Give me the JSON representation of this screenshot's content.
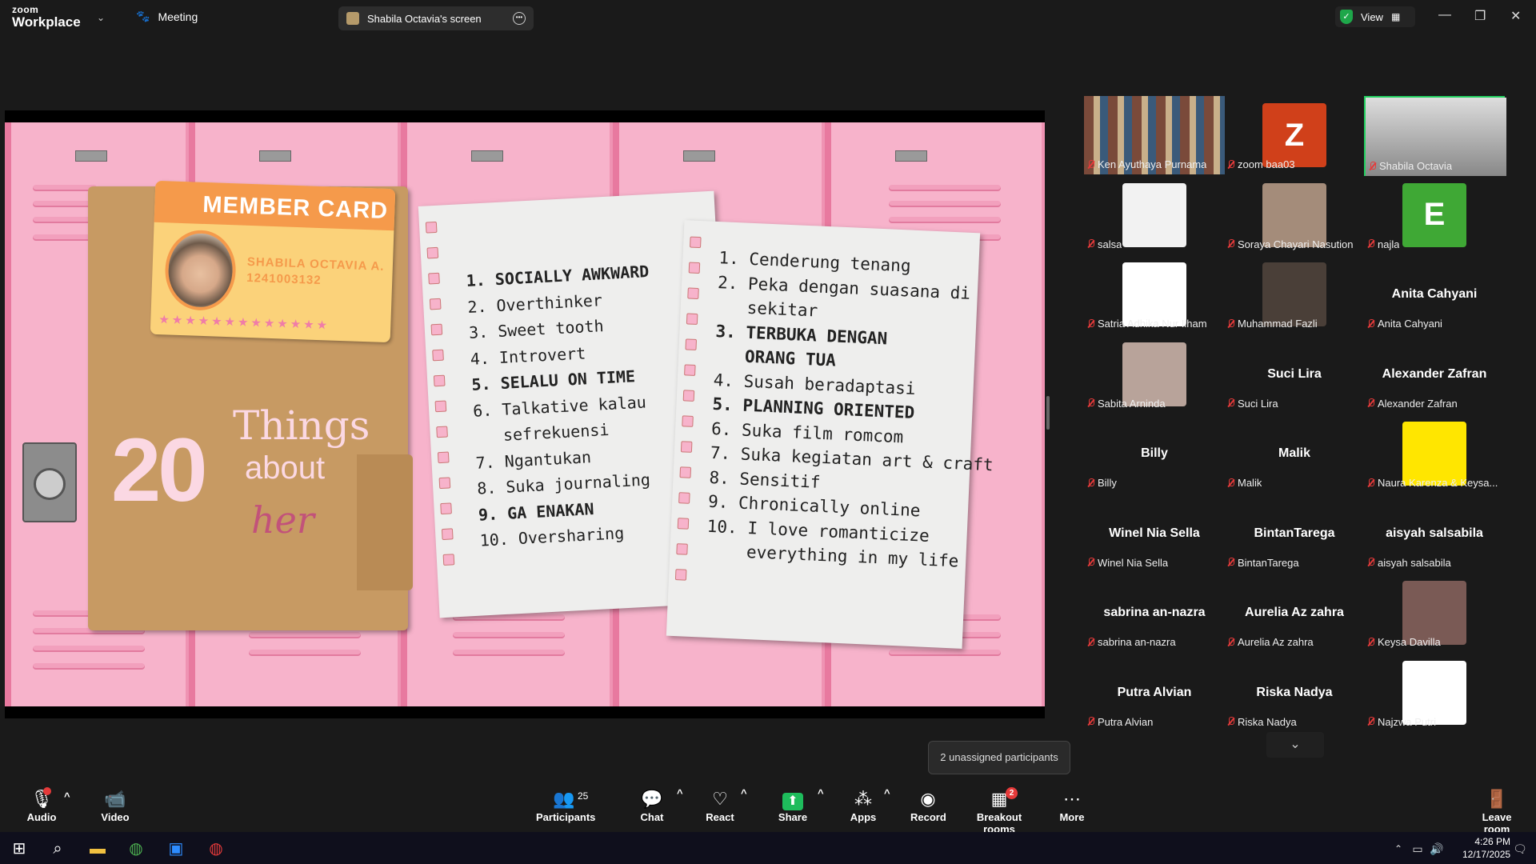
{
  "app": {
    "brand_small": "zoom",
    "brand_big": "Workplace"
  },
  "tabs": {
    "meeting": "Meeting",
    "screen": "Shabila Octavia's screen"
  },
  "view_label": "View",
  "slide": {
    "card_title": "MEMBER CARD",
    "card_name": "SHABILA OCTAVIA A.",
    "card_id": "1241003132",
    "card_stars": "★★★★★★★★★★★★★",
    "big_number": "20",
    "things": "Things",
    "about": "about",
    "her": "her",
    "list1": [
      {
        "t": "1. SOCIALLY AWKWARD",
        "b": true
      },
      {
        "t": "2. Overthinker",
        "b": false
      },
      {
        "t": "3. Sweet tooth",
        "b": false
      },
      {
        "t": "4. Introvert",
        "b": false
      },
      {
        "t": "5. SELALU ON TIME",
        "b": true
      },
      {
        "t": "6. Talkative kalau",
        "b": false
      },
      {
        "t": "   sefrekuensi",
        "b": false
      },
      {
        "t": "7. Ngantukan",
        "b": false
      },
      {
        "t": "8. Suka journaling",
        "b": false
      },
      {
        "t": "9. GA ENAKAN",
        "b": true
      },
      {
        "t": "10. Oversharing",
        "b": false
      }
    ],
    "list2": [
      {
        "t": "1. Cenderung tenang",
        "b": false
      },
      {
        "t": "2. Peka dengan suasana di",
        "b": false
      },
      {
        "t": "   sekitar",
        "b": false
      },
      {
        "t": "3. TERBUKA DENGAN",
        "b": true
      },
      {
        "t": "   ORANG TUA",
        "b": true
      },
      {
        "t": "4. Susah beradaptasi",
        "b": false
      },
      {
        "t": "5. PLANNING ORIENTED",
        "b": true
      },
      {
        "t": "6. Suka film romcom",
        "b": false
      },
      {
        "t": "7. Suka kegiatan art & craft",
        "b": false
      },
      {
        "t": "8. Sensitif",
        "b": false
      },
      {
        "t": "9. Chronically online",
        "b": false
      },
      {
        "t": "10. I love romanticize",
        "b": false
      },
      {
        "t": "    everything in my life",
        "b": false
      }
    ]
  },
  "participants": [
    {
      "label": "Ken Ayuthaya Purnama",
      "big": "",
      "kind": "photo",
      "color": "#8a7a6a"
    },
    {
      "label": "zoom baa03",
      "big": "Z",
      "kind": "avatar",
      "color": "#d0401a"
    },
    {
      "label": "Shabila Octavia",
      "big": "",
      "kind": "photo",
      "color": "#6d6d70"
    },
    {
      "label": "salsa",
      "big": "",
      "kind": "avatar",
      "color": "#f2f2f2"
    },
    {
      "label": "Soraya Chayari Nasution",
      "big": "",
      "kind": "avatar",
      "color": "#a48c7a"
    },
    {
      "label": "najla",
      "big": "E",
      "kind": "avatar",
      "color": "#3fa835"
    },
    {
      "label": "Satria Adhika Nur Ilham",
      "big": "",
      "kind": "avatar",
      "color": "#ffffff"
    },
    {
      "label": "Muhammad Fazli",
      "big": "",
      "kind": "avatar",
      "color": "#4a3f38"
    },
    {
      "label": "Anita Cahyani",
      "big": "Anita Cahyani",
      "kind": "name",
      "color": ""
    },
    {
      "label": "Sabita Arninda",
      "big": "",
      "kind": "avatar",
      "color": "#b8a39a"
    },
    {
      "label": "Suci Lira",
      "big": "Suci Lira",
      "kind": "name",
      "color": ""
    },
    {
      "label": "Alexander Zafran",
      "big": "Alexander Zafran",
      "kind": "name",
      "color": ""
    },
    {
      "label": "Billy",
      "big": "Billy",
      "kind": "name",
      "color": ""
    },
    {
      "label": "Malik",
      "big": "Malik",
      "kind": "name",
      "color": ""
    },
    {
      "label": "Naura Karenza & Keysa...",
      "big": "",
      "kind": "avatar",
      "color": "#ffe600"
    },
    {
      "label": "Winel Nia Sella",
      "big": "Winel Nia Sella",
      "kind": "name",
      "color": ""
    },
    {
      "label": "BintanTarega",
      "big": "BintanTarega",
      "kind": "name",
      "color": ""
    },
    {
      "label": "aisyah salsabila",
      "big": "aisyah salsabila",
      "kind": "name",
      "color": ""
    },
    {
      "label": "sabrina an-nazra",
      "big": "sabrina an-nazra",
      "kind": "name",
      "color": ""
    },
    {
      "label": "Aurelia Az zahra",
      "big": "Aurelia Az zahra",
      "kind": "name",
      "color": ""
    },
    {
      "label": "Keysa Davilla",
      "big": "",
      "kind": "avatar",
      "color": "#7a5a55"
    },
    {
      "label": "Putra Alvian",
      "big": "Putra Alvian",
      "kind": "name",
      "color": ""
    },
    {
      "label": "Riska Nadya",
      "big": "Riska Nadya",
      "kind": "name",
      "color": ""
    },
    {
      "label": "Najzwa Putri",
      "big": "",
      "kind": "avatar",
      "color": "#ffffff"
    }
  ],
  "unassigned": "2 unassigned participants",
  "toolbar": {
    "audio": "Audio",
    "video": "Video",
    "participants": "Participants",
    "participants_count": "25",
    "chat": "Chat",
    "react": "React",
    "share": "Share",
    "apps": "Apps",
    "record": "Record",
    "breakout": "Breakout rooms",
    "breakout_badge": "2",
    "more": "More",
    "leave": "Leave room"
  },
  "taskbar": {
    "time": "4:26 PM",
    "date": "12/17/2025"
  }
}
